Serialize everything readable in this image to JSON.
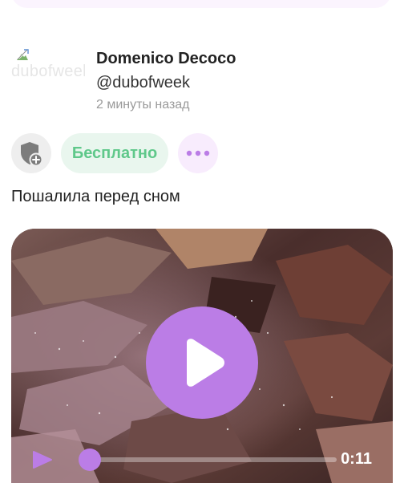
{
  "post": {
    "author": {
      "avatar_alt": "dubofweek",
      "name": "Domenico Decoco",
      "handle": "@dubofweek",
      "time": "2 минуты назад"
    },
    "actions": {
      "shield_icon": "shield-plus-icon",
      "price_label": "Бесплатно",
      "more_icon": "more-dots-icon"
    },
    "text": "Пошалила перед сном",
    "media": {
      "type": "video",
      "duration": "0:11",
      "progress": 0.0
    }
  },
  "colors": {
    "accent": "#bb7de6",
    "free_green": "#5fc88a",
    "free_bg": "#e9f6ee",
    "more_bg": "#f8ecfd"
  }
}
